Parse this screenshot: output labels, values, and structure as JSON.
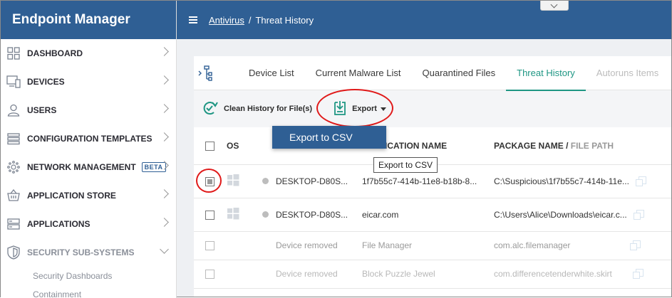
{
  "app": {
    "title": "Endpoint Manager"
  },
  "breadcrumb": {
    "link": "Antivirus",
    "separator": "/",
    "current": "Threat History"
  },
  "sidebar": {
    "items": [
      {
        "label": "DASHBOARD",
        "icon": "dashboard-grid-icon"
      },
      {
        "label": "DEVICES",
        "icon": "devices-icon"
      },
      {
        "label": "USERS",
        "icon": "user-icon"
      },
      {
        "label": "CONFIGURATION TEMPLATES",
        "icon": "templates-icon"
      },
      {
        "label": "NETWORK MANAGEMENT",
        "icon": "network-icon",
        "badge": "BETA"
      },
      {
        "label": "APPLICATION STORE",
        "icon": "store-basket-icon"
      },
      {
        "label": "APPLICATIONS",
        "icon": "applications-icon"
      },
      {
        "label": "SECURITY SUB-SYSTEMS",
        "icon": "shield-icon"
      }
    ],
    "sub_items": [
      "Security Dashboards",
      "Containment"
    ]
  },
  "tabs": [
    "Device List",
    "Current Malware List",
    "Quarantined Files",
    "Threat History",
    "Autoruns Items"
  ],
  "active_tab": "Threat History",
  "toolbar": {
    "clean_history_label": "Clean History for File(s)",
    "export_label": "Export"
  },
  "dropdown": {
    "export_csv": "Export to CSV"
  },
  "tooltip": {
    "text": "Export to CSV"
  },
  "table": {
    "headers": {
      "os": "OS",
      "app_name": "APPLICATION NAME",
      "package_main": "PACKAGE NAME / ",
      "package_muted": "FILE PATH"
    },
    "rows": [
      {
        "device": "DESKTOP-D80S...",
        "app": "1f7b55c7-414b-11e8-b18b-8...",
        "path": "C:\\Suspicious\\1f7b55c7-414b-11e...",
        "checked": true,
        "os_icon": "windows-icon"
      },
      {
        "device": "DESKTOP-D80S...",
        "app": "eicar.com",
        "path": "C:\\Users\\Alice\\Downloads\\eicar.c...",
        "checked": false,
        "os_icon": "windows-icon"
      },
      {
        "device": "Device removed",
        "app": "File Manager",
        "path": "com.alc.filemanager",
        "checked": false
      },
      {
        "device": "Device removed",
        "app": "Block Puzzle Jewel",
        "path": "com.differencetenderwhite.skirt",
        "checked": false
      }
    ]
  },
  "colors": {
    "brand": "#2f5f94",
    "accent": "#1e9683",
    "highlight": "#e01a1a"
  }
}
